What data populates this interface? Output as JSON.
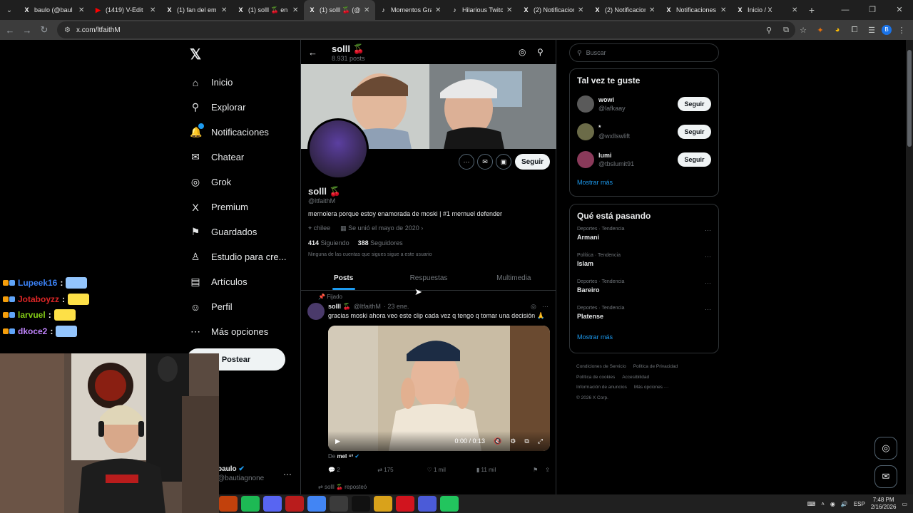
{
  "browser": {
    "tabs": [
      {
        "title": "baulo (@baul",
        "favicon": "X",
        "fav_color": "#ffffff"
      },
      {
        "title": "(1419) V-Edit",
        "favicon": "▶",
        "fav_color": "#ff0000"
      },
      {
        "title": "(1) fan del em",
        "favicon": "X",
        "fav_color": "#ffffff"
      },
      {
        "title": "(1) solll 🍒 en X",
        "favicon": "X",
        "fav_color": "#ffffff"
      },
      {
        "title": "(1) solll 🍒 (@",
        "favicon": "X",
        "fav_color": "#ffffff",
        "active": true
      },
      {
        "title": "Momentos Gra",
        "favicon": "♪",
        "fav_color": "#ffffff"
      },
      {
        "title": "Hilarious Twitch",
        "favicon": "♪",
        "fav_color": "#ffffff"
      },
      {
        "title": "(2) Notificacion",
        "favicon": "X",
        "fav_color": "#ffffff"
      },
      {
        "title": "(2) Notificacion",
        "favicon": "X",
        "fav_color": "#ffffff"
      },
      {
        "title": "Notificaciones",
        "favicon": "X",
        "fav_color": "#ffffff"
      },
      {
        "title": "Inicio / X",
        "favicon": "X",
        "fav_color": "#ffffff"
      }
    ],
    "url": "x.com/ltfaithM"
  },
  "sidebar": {
    "items": [
      {
        "label": "Inicio",
        "icon": "home-icon",
        "glyph": "⌂"
      },
      {
        "label": "Explorar",
        "icon": "search-icon",
        "glyph": "⚲"
      },
      {
        "label": "Notificaciones",
        "icon": "bell-icon",
        "glyph": "🔔"
      },
      {
        "label": "Chatear",
        "icon": "mail-icon",
        "glyph": "✉"
      },
      {
        "label": "Grok",
        "icon": "grok-icon",
        "glyph": "◎"
      },
      {
        "label": "Premium",
        "icon": "x-icon",
        "glyph": "X"
      },
      {
        "label": "Guardados",
        "icon": "bookmark-icon",
        "glyph": "⚑"
      },
      {
        "label": "Estudio para cre...",
        "icon": "studio-icon",
        "glyph": "♙"
      },
      {
        "label": "Artículos",
        "icon": "article-icon",
        "glyph": "▤"
      },
      {
        "label": "Perfil",
        "icon": "user-icon",
        "glyph": "☺"
      },
      {
        "label": "Más opciones",
        "icon": "more-icon",
        "glyph": "⋯"
      }
    ],
    "post_button": "Postear",
    "account_name": "baulo",
    "account_handle": "@bautiagnone"
  },
  "chat": [
    {
      "user": "Lupeek16",
      "color": "#3b82f6"
    },
    {
      "user": "Jotaboyzz",
      "color": "#dc2626"
    },
    {
      "user": "larvuel",
      "color": "#84cc16"
    },
    {
      "user": "dkoce2",
      "color": "#c084fc"
    }
  ],
  "profile": {
    "topbar_name": "solll 🍒",
    "posts_count": "8.931 posts",
    "name": "solll 🍒",
    "handle": "@ltfaithM",
    "bio": "mernolera porque estoy enamorada de moski | #1 mernuel defender",
    "location": "chilee",
    "joined": "Se unió el mayo de 2020",
    "following_count": "414",
    "following_label": "Siguiendo",
    "followers_count": "388",
    "followers_label": "Seguidores",
    "note": "Ninguna de las cuentas que sigues sigue a este usuario",
    "follow_button": "Seguir",
    "tabs": [
      "Posts",
      "Respuestas",
      "Multimedia"
    ]
  },
  "tweet": {
    "pinned_label": "Fijado",
    "name": "solll 🍒",
    "handle": "@ltfaithM",
    "date": "· 23 ene.",
    "text": "gracias moski ahora veo este clip cada vez q tengo q tomar una decisión 🙏",
    "video_time": "0:00 / 0:13",
    "from_prefix": "De",
    "from_user": "mel ⁴³",
    "replies": "2",
    "reposts": "175",
    "likes": "1 mil",
    "views": "11 mil",
    "repost_label": "solll 🍒 reposteó"
  },
  "right": {
    "search_placeholder": "Buscar",
    "who_to_follow_title": "Tal vez te guste",
    "who_to_follow": [
      {
        "name": "wowi",
        "handle": "@lafkaay",
        "button": "Seguir",
        "avatar_color": "#5a5a5a"
      },
      {
        "name": "*",
        "handle": "@wxllswlift",
        "button": "Seguir",
        "avatar_color": "#6b6b48"
      },
      {
        "name": "lumi",
        "handle": "@tbslumit91",
        "button": "Seguir",
        "avatar_color": "#8a3a5a"
      }
    ],
    "show_more": "Mostrar más",
    "trends_title": "Qué está pasando",
    "trends": [
      {
        "context": "Deportes · Tendencia",
        "topic": "Armani"
      },
      {
        "context": "Política · Tendencia",
        "topic": "Islam"
      },
      {
        "context": "Deportes · Tendencia",
        "topic": "Bareiro"
      },
      {
        "context": "Deportes · Tendencia",
        "topic": "Platense"
      }
    ],
    "trends_more": "Mostrar más",
    "footer": [
      "Condiciones de Servicio",
      "Política de Privacidad",
      "Política de cookies",
      "Accesibilidad",
      "Información de anuncios",
      "Más opciones ···",
      "© 2026 X Corp."
    ]
  },
  "taskbar": {
    "apps": [
      {
        "icon": "copilot-icon",
        "color": "#c2410c"
      },
      {
        "icon": "spotify-icon",
        "color": "#1db954"
      },
      {
        "icon": "discord-icon",
        "color": "#5865f2"
      },
      {
        "icon": "voicemod-icon",
        "color": "#b91c1c"
      },
      {
        "icon": "chrome-icon",
        "color": "#4285f4"
      },
      {
        "icon": "obs-icon",
        "color": "#3b3b3b"
      },
      {
        "icon": "capcut-icon",
        "color": "#111111"
      },
      {
        "icon": "folder-icon",
        "color": "#d9a21b"
      },
      {
        "icon": "opera-icon",
        "color": "#d1141e"
      },
      {
        "icon": "app-icon",
        "color": "#4b5bd8"
      },
      {
        "icon": "kick-icon",
        "color": "#22c55e"
      }
    ],
    "language": "ESP",
    "time": "7:48 PM",
    "date": "2/16/2026"
  }
}
